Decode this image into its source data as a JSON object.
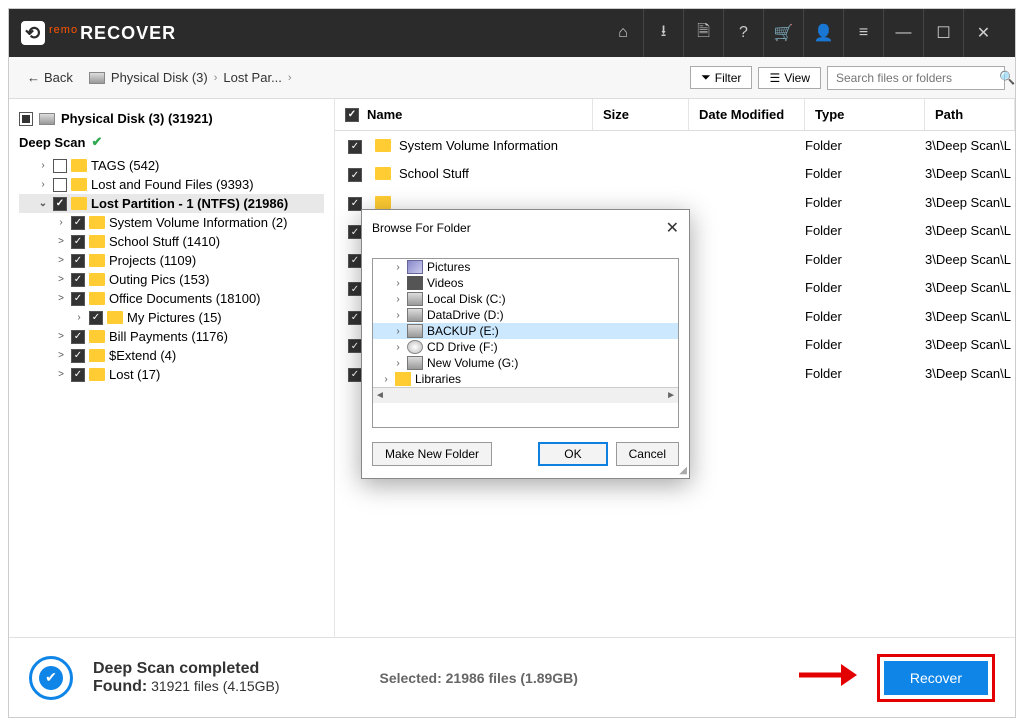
{
  "app": {
    "brand_prefix": "remo",
    "brand": "RECOVER"
  },
  "toolbar": {
    "back": "Back",
    "breadcrumb_disk": "Physical Disk (3)",
    "breadcrumb_part": "Lost Par...",
    "filter": "Filter",
    "view": "View",
    "search_placeholder": "Search files or folders"
  },
  "sidebar": {
    "root": "Physical Disk (3) (31921)",
    "scan_label": "Deep Scan",
    "nodes": [
      {
        "label": "TAGS (542)",
        "chk": false,
        "indent": 1
      },
      {
        "label": "Lost and Found Files (9393)",
        "chk": false,
        "indent": 1
      },
      {
        "label": "Lost Partition - 1 (NTFS) (21986)",
        "chk": true,
        "indent": 1,
        "selected": true,
        "expanded": true
      },
      {
        "label": "System Volume Information (2)",
        "chk": true,
        "indent": 2
      },
      {
        "label": "School Stuff (1410)",
        "chk": true,
        "indent": 2,
        "expander": ">"
      },
      {
        "label": "Projects (1109)",
        "chk": true,
        "indent": 2,
        "expander": ">"
      },
      {
        "label": "Outing Pics (153)",
        "chk": true,
        "indent": 2,
        "expander": ">"
      },
      {
        "label": "Office Documents (18100)",
        "chk": true,
        "indent": 2,
        "expander": ">"
      },
      {
        "label": "My Pictures (15)",
        "chk": true,
        "indent": 3
      },
      {
        "label": "Bill Payments (1176)",
        "chk": true,
        "indent": 2,
        "expander": ">"
      },
      {
        "label": "$Extend (4)",
        "chk": true,
        "indent": 2,
        "expander": ">"
      },
      {
        "label": "Lost (17)",
        "chk": true,
        "indent": 2,
        "expander": ">"
      }
    ]
  },
  "columns": {
    "name": "Name",
    "size": "Size",
    "date": "Date Modified",
    "type": "Type",
    "path": "Path"
  },
  "rows": [
    {
      "name": "System Volume Information",
      "type": "Folder",
      "path": "3\\Deep Scan\\L"
    },
    {
      "name": "School Stuff",
      "type": "Folder",
      "path": "3\\Deep Scan\\L"
    },
    {
      "name": "",
      "type": "Folder",
      "path": "3\\Deep Scan\\L"
    },
    {
      "name": "",
      "type": "Folder",
      "path": "3\\Deep Scan\\L"
    },
    {
      "name": "",
      "type": "Folder",
      "path": "3\\Deep Scan\\L"
    },
    {
      "name": "",
      "type": "Folder",
      "path": "3\\Deep Scan\\L"
    },
    {
      "name": "",
      "type": "Folder",
      "path": "3\\Deep Scan\\L"
    },
    {
      "name": "",
      "type": "Folder",
      "path": "3\\Deep Scan\\L"
    },
    {
      "name": "",
      "type": "Folder",
      "path": "3\\Deep Scan\\L"
    }
  ],
  "footer": {
    "title": "Deep Scan completed",
    "found_label": "Found:",
    "found_value": "31921 files (4.15GB)",
    "selected_label": "Selected:",
    "selected_value": "21986 files (1.89GB)",
    "recover": "Recover"
  },
  "dialog": {
    "title": "Browse For Folder",
    "items": [
      {
        "label": "Pictures",
        "ico": "pic-ico"
      },
      {
        "label": "Videos",
        "ico": "vid-ico"
      },
      {
        "label": "Local Disk (C:)",
        "ico": "drv-ico"
      },
      {
        "label": "DataDrive (D:)",
        "ico": "drv-ico"
      },
      {
        "label": "BACKUP (E:)",
        "ico": "drv-ico",
        "sel": true
      },
      {
        "label": "CD Drive (F:)",
        "ico": "cd-ico"
      },
      {
        "label": "New Volume (G:)",
        "ico": "drv-ico"
      }
    ],
    "libraries": "Libraries",
    "make_folder": "Make New Folder",
    "ok": "OK",
    "cancel": "Cancel"
  }
}
